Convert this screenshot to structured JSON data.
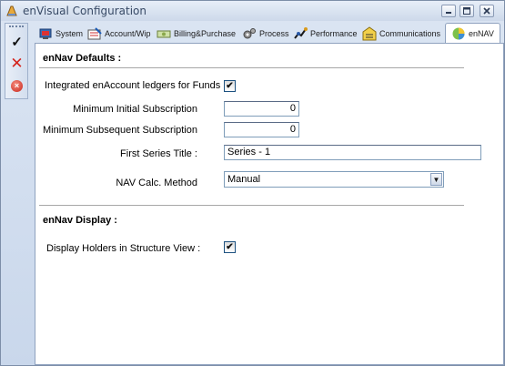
{
  "window": {
    "title": "enVisual Configuration"
  },
  "toolbar": {
    "icons": [
      "check-icon",
      "x-icon",
      "cancel-circle-icon"
    ]
  },
  "tabs": [
    {
      "label": "System",
      "icon": "system-icon"
    },
    {
      "label": "Account/Wip",
      "icon": "account-icon"
    },
    {
      "label": "Billing&Purchase",
      "icon": "money-icon"
    },
    {
      "label": "Process",
      "icon": "gears-icon"
    },
    {
      "label": "Performance",
      "icon": "performance-icon"
    },
    {
      "label": "Communications",
      "icon": "document-icon"
    },
    {
      "label": "enNAV",
      "icon": "pie-icon",
      "active": true
    }
  ],
  "defaults": {
    "header": "enNav Defaults :",
    "integrated_label": "Integrated enAccount ledgers for Funds :",
    "integrated_checked": "✔",
    "min_initial_label": "Minimum Initial Subscription",
    "min_initial_value": "0",
    "min_subsequent_label": "Minimum Subsequent Subscription",
    "min_subsequent_value": "0",
    "series_title_label": "First Series Title :",
    "series_title_value": "Series - 1",
    "nav_calc_label": "NAV Calc. Method",
    "nav_calc_value": "Manual"
  },
  "display": {
    "header": "enNav Display :",
    "holders_label": "Display Holders in Structure View :",
    "holders_checked": "✔"
  },
  "colors": {
    "title_text": "#384a66",
    "panel_bg": "#ffffff",
    "frame_bg": "#c9d7eb",
    "close_red": "#d4231b"
  }
}
